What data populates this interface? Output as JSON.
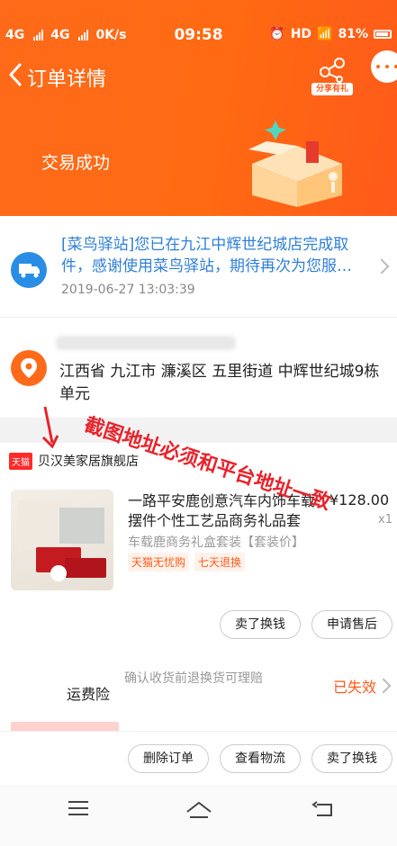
{
  "statusbar": {
    "network1": "4G",
    "network2": "4G",
    "speed": "0K/s",
    "time": "09:58",
    "hd": "HD",
    "battery": "81%"
  },
  "nav": {
    "title": "订单详情",
    "share_badge": "分享有礼"
  },
  "order": {
    "status": "交易成功"
  },
  "logistics": {
    "message": "[菜鸟驿站]您已在九江中辉世纪城店完成取件，感谢使用菜鸟驿站，期待再次为您服…",
    "time": "2019-06-27 13:03:39"
  },
  "address": {
    "text": "江西省 九江市 濂溪区 五里街道 中辉世纪城9栋 单元"
  },
  "shop": {
    "badge": "天猫",
    "name": "贝汉美家居旗舰店"
  },
  "product": {
    "title": "一路平安鹿创意汽车内饰车载摆件个性工艺品商务礼品套",
    "price": "¥128.00",
    "qty": "x1",
    "sku": "车载鹿商务礼盒套装【套装价】",
    "tags": [
      "天猫无忧购",
      "七天退换"
    ]
  },
  "annotation": {
    "text": "截图地址必须和平台地址一致"
  },
  "actions": {
    "resell": "卖了换钱",
    "after_sale": "申请售后"
  },
  "insurance": {
    "label": "运费险",
    "desc": "确认收货前退换货可理赔",
    "status": "已失效"
  },
  "bottom": {
    "delete": "删除订单",
    "logistics": "查看物流",
    "resell": "卖了换钱"
  },
  "colors": {
    "brand": "#ff6a1a",
    "link": "#2f7fd6",
    "annotation": "#e8232b"
  }
}
